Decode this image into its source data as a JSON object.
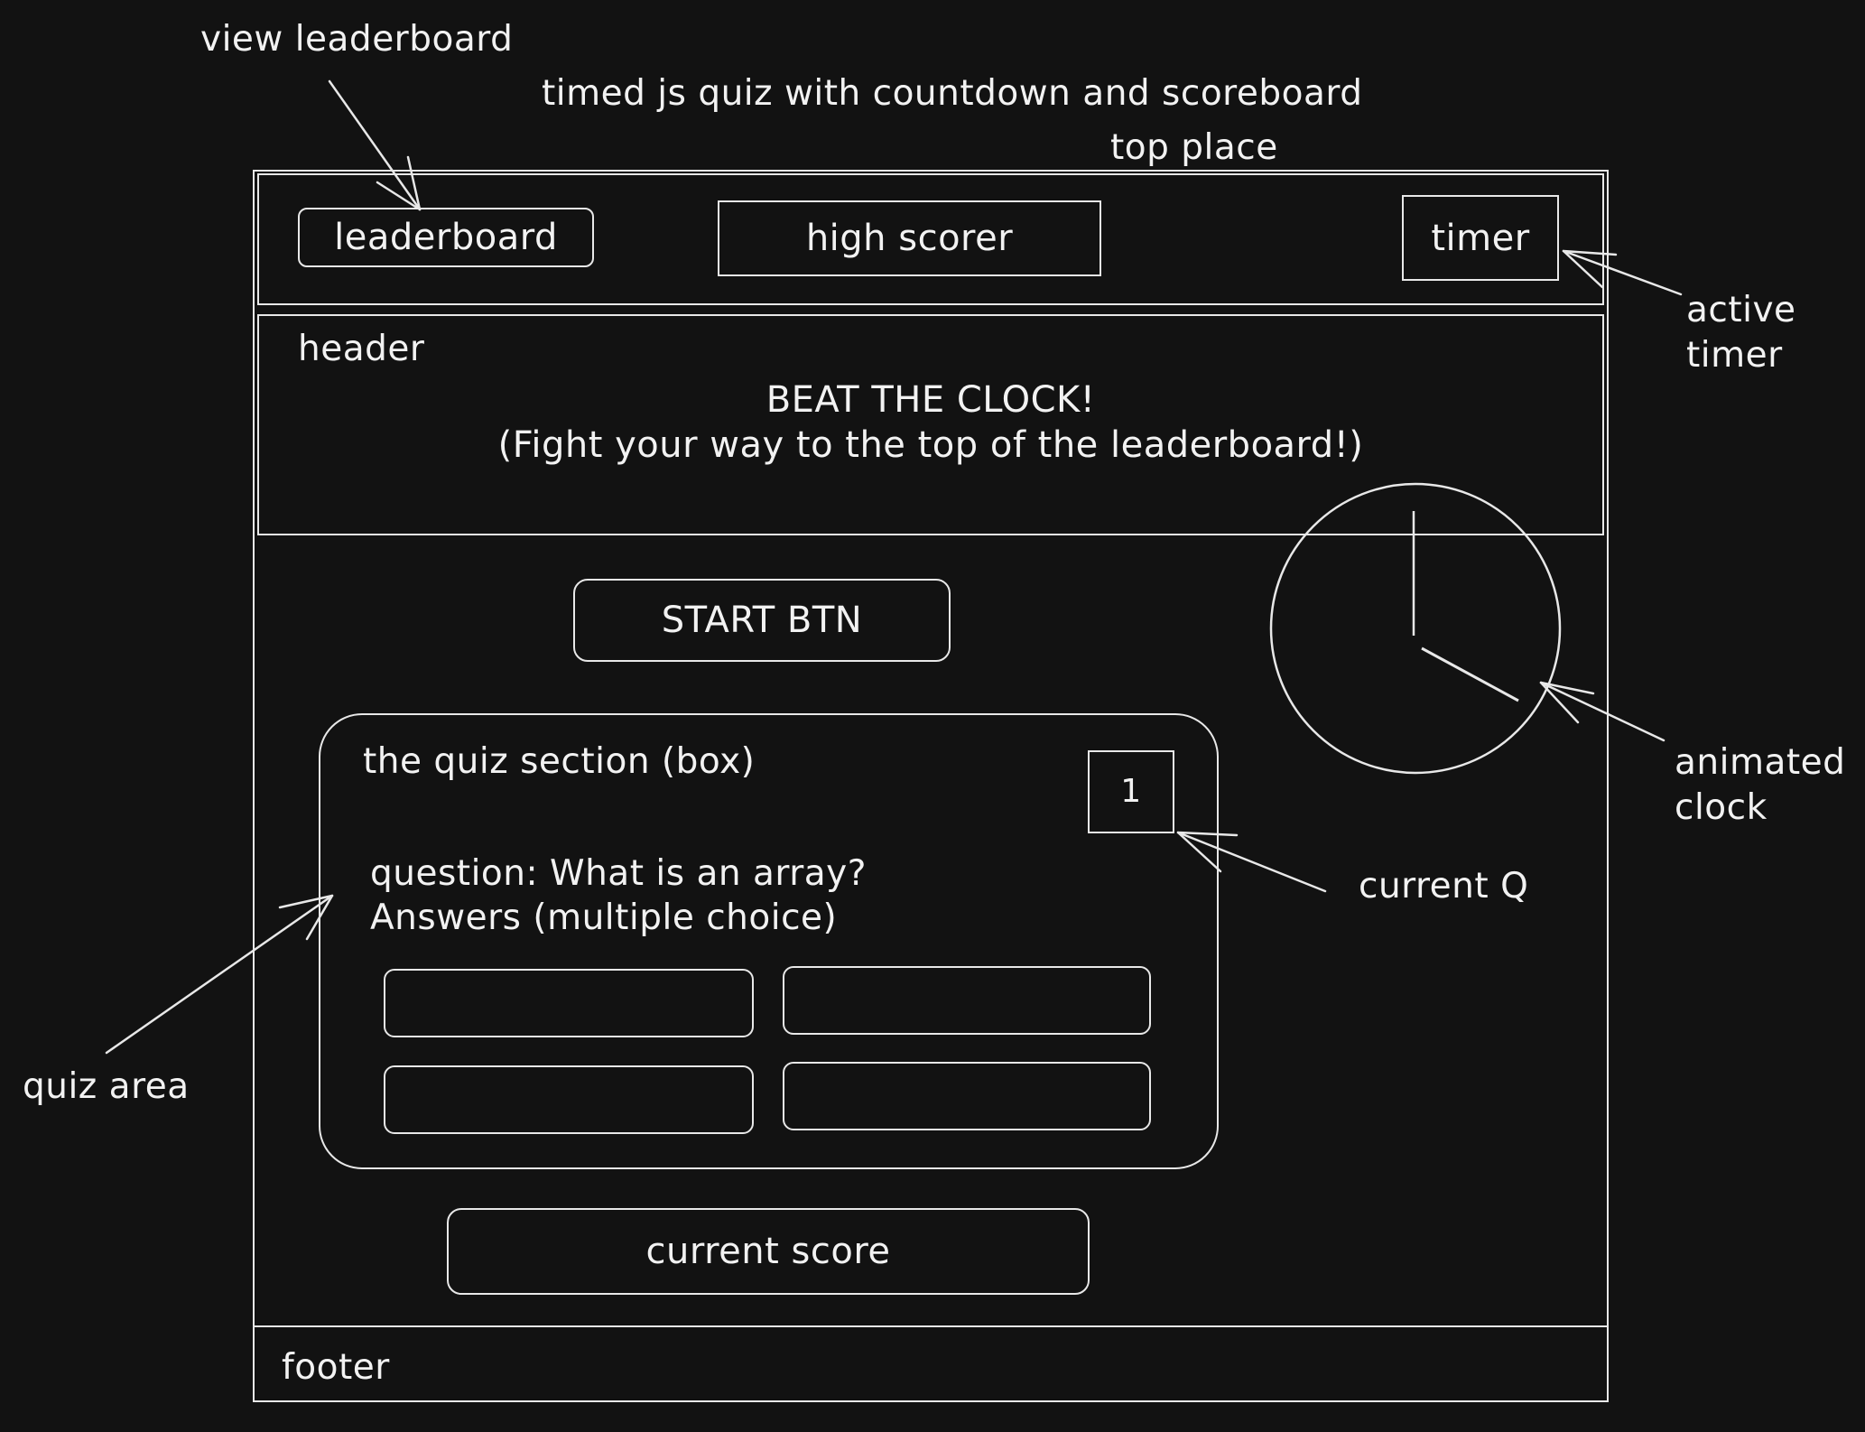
{
  "annotations": {
    "view_leaderboard": "view leaderboard",
    "page_title_note": "timed js quiz with countdown and scoreboard",
    "top_place": "top place",
    "active_timer_line1": "active",
    "active_timer_line2": "timer",
    "animated_clock_line1": "animated",
    "animated_clock_line2": "clock",
    "current_q": "current Q",
    "quiz_area": "quiz area"
  },
  "nav": {
    "leaderboard_label": "leaderboard",
    "high_scorer_label": "high scorer",
    "timer_label": "timer"
  },
  "header": {
    "label": "header",
    "title": "BEAT THE CLOCK!",
    "subtitle": "(Fight your way to the top of the leaderboard!)"
  },
  "start_button_label": "START BTN",
  "quiz": {
    "section_label": "the quiz section (box)",
    "question_number": "1",
    "question": "question: What is an array?",
    "answers_label": "Answers (multiple choice)",
    "answers": [
      "",
      "",
      "",
      ""
    ]
  },
  "score_label": "current score",
  "footer_label": "footer",
  "colors": {
    "background": "#121212",
    "stroke": "#e8e8e8",
    "text": "#f2f2f2"
  }
}
